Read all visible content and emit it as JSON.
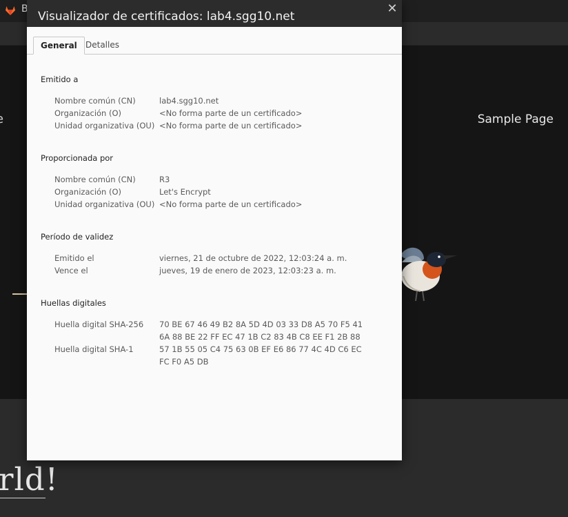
{
  "browser": {
    "tab_title": "B",
    "nav_partial": "e",
    "nav_sample": "Sample Page",
    "hello_partial": "rld!"
  },
  "dialog": {
    "title": "Visualizador de certificados: lab4.sgg10.net",
    "close_glyph": "✕",
    "tabs": [
      {
        "label": "General",
        "active": true
      },
      {
        "label": "Detalles",
        "active": false
      }
    ],
    "issued_to": {
      "heading": "Emitido a",
      "rows": [
        {
          "label": "Nombre común (CN)",
          "value": "lab4.sgg10.net"
        },
        {
          "label": "Organización (O)",
          "value": "<No forma parte de un certificado>"
        },
        {
          "label": "Unidad organizativa (OU)",
          "value": "<No forma parte de un certificado>"
        }
      ]
    },
    "issued_by": {
      "heading": "Proporcionada por",
      "rows": [
        {
          "label": "Nombre común (CN)",
          "value": "R3"
        },
        {
          "label": "Organización (O)",
          "value": "Let's Encrypt"
        },
        {
          "label": "Unidad organizativa (OU)",
          "value": "<No forma parte de un certificado>"
        }
      ]
    },
    "validity": {
      "heading": "Período de validez",
      "rows": [
        {
          "label": "Emitido el",
          "value": "viernes, 21 de octubre de 2022, 12:03:24 a. m."
        },
        {
          "label": "Vence el",
          "value": "jueves, 19 de enero de 2023, 12:03:23 a. m."
        }
      ]
    },
    "fingerprints": {
      "heading": "Huellas digitales",
      "sha256": {
        "label": "Huella digital SHA-256",
        "line1": "70 BE 67 46 49 B2 8A 5D 4D 03 33 D8 A5 70 F5 41",
        "line2": "6A 88 BE 22 FF EC 47 1B C2 83 4B C8 EE F1 2B 88"
      },
      "sha1": {
        "label": "Huella digital SHA-1",
        "line1": "57 1B 55 05 C4 75 63 0B EF E6 86 77 4C 4D C6 EC",
        "line2": "FC F0 A5 DB"
      }
    }
  }
}
